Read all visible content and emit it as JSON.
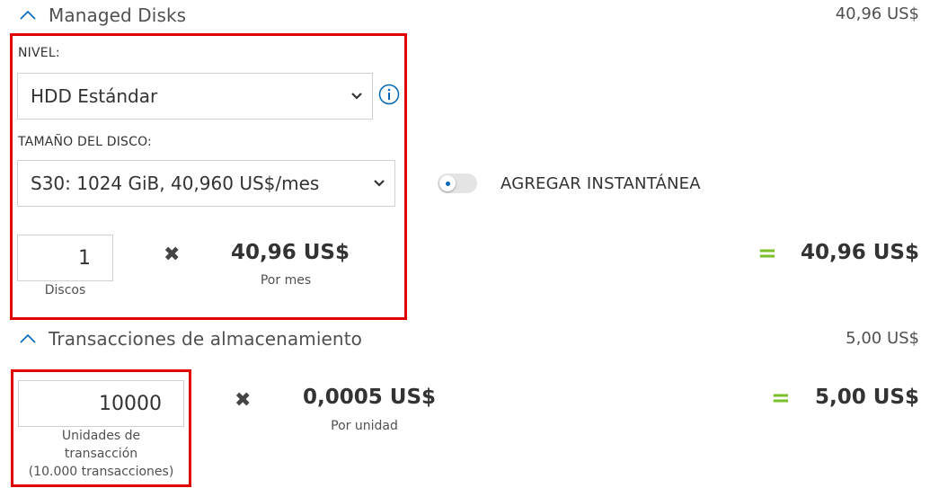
{
  "managed_disks": {
    "title": "Managed Disks",
    "total": "40,96 US$",
    "tier_label": "NIVEL:",
    "tier_value": "HDD Estándar",
    "size_label": "TAMAÑO DEL DISCO:",
    "size_value": "S30: 1024 GiB, 40,960 US$/mes",
    "snapshot_label": "AGREGAR INSTANTÁNEA",
    "snapshot_enabled": false,
    "quantity": "1",
    "quantity_label": "Discos",
    "times_symbol": "✖",
    "unit_price": "40,96 US$",
    "unit_price_label": "Por mes",
    "equals_symbol": "=",
    "subtotal": "40,96 US$"
  },
  "storage_transactions": {
    "title": "Transacciones de almacenamiento",
    "total": "5,00 US$",
    "quantity": "10000",
    "quantity_label_line1": "Unidades de",
    "quantity_label_line2": "transacción",
    "quantity_label_line3": "(10.000 transacciones)",
    "times_symbol": "✖",
    "unit_price": "0,0005 US$",
    "unit_price_label": "Por unidad",
    "equals_symbol": "=",
    "subtotal": "5,00 US$"
  },
  "colors": {
    "highlight_border": "#e00000",
    "accent_blue": "#0067b8",
    "equals_green": "#7bbf2a"
  },
  "icons": {
    "collapse": "chevron-up-icon",
    "dropdown": "chevron-down-icon",
    "info": "info-icon",
    "multiply": "multiply-icon"
  }
}
